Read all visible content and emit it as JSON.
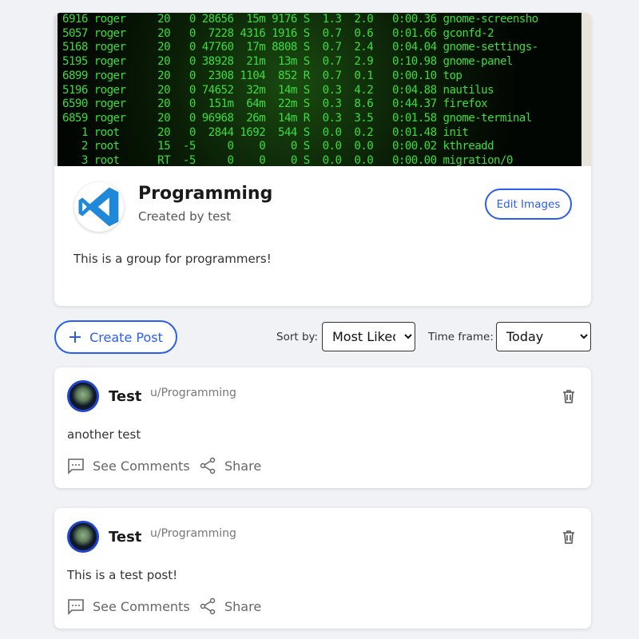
{
  "group": {
    "banner_lines": [
      "6916 roger     20   0 28656  15m 9176 S  1.3  2.0   0:00.36 gnome-screensho",
      "5057 roger     20   0  7228 4316 1916 S  0.7  0.6   0:01.66 gconfd-2",
      "5168 roger     20   0 47760  17m 8808 S  0.7  2.4   0:04.04 gnome-settings-",
      "5195 roger     20   0 38928  21m  13m S  0.7  2.9   0:10.98 gnome-panel",
      "6899 roger     20   0  2308 1104  852 R  0.7  0.1   0:00.10 top",
      "5196 roger     20   0 74652  32m  14m S  0.3  4.2   0:04.88 nautilus",
      "6590 roger     20   0  151m  64m  22m S  0.3  8.6   0:44.37 firefox",
      "6859 roger     20   0 96968  26m  14m R  0.3  3.5   0:01.58 gnome-terminal",
      "   1 root      20   0  2844 1692  544 S  0.0  0.2   0:01.48 init",
      "   2 root      15  -5     0    0    0 S  0.0  0.0   0:00.02 kthreadd",
      "   3 root      RT  -5     0    0    0 S  0.0  0.0   0:00.00 migration/0"
    ],
    "title": "Programming",
    "created_by": "Created by test",
    "edit_label": "Edit Images",
    "description": "This is a group for programmers!"
  },
  "controls": {
    "create_label": "Create Post",
    "sort_label": "Sort by:",
    "sort_value": "Most Liked",
    "time_label": "Time frame:",
    "time_value": "Today"
  },
  "posts": [
    {
      "author": "Test",
      "group": "u/Programming",
      "body": "another test",
      "comments_label": "See Comments",
      "share_label": "Share"
    },
    {
      "author": "Test",
      "group": "u/Programming",
      "body": "This is a test post!",
      "comments_label": "See Comments",
      "share_label": "Share"
    }
  ],
  "colors": {
    "accent": "#2a5ef0",
    "background": "#f0f2f5"
  }
}
